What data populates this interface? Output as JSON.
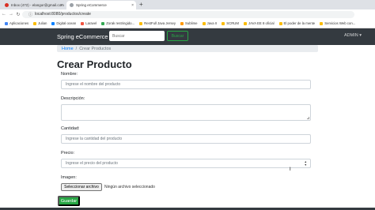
{
  "browser": {
    "tabs": [
      {
        "title": "Inbox (472) - elangor@gmail.com",
        "close": "×",
        "color": "#d93025"
      },
      {
        "title": "Spring eCommerce",
        "close": "×",
        "color": "#5f6368"
      }
    ],
    "new_tab": "+",
    "url": "localhost:8080/productos/create",
    "bookmarks": [
      {
        "label": "Aplicaciones",
        "color": "#4285f4"
      },
      {
        "label": "Julian",
        "color": "#fbbc04"
      },
      {
        "label": "Digital ocean",
        "color": "#0080ff"
      },
      {
        "label": "Laravel",
        "color": "#f05340"
      },
      {
        "label": "Zorak restringido...",
        "color": "#34a853"
      },
      {
        "label": "RestFull Java Jersey",
        "color": "#fbbc04"
      },
      {
        "label": "Sublime",
        "color": "#ff9800"
      },
      {
        "label": "Java II",
        "color": "#fbbc04"
      },
      {
        "label": "SCRUM",
        "color": "#fbbc04"
      },
      {
        "label": "JAVA EE 8 oficial",
        "color": "#fbbc04"
      },
      {
        "label": "El poder de la mente",
        "color": "#fbbc04"
      },
      {
        "label": "Servicios Web con...",
        "color": "#fbbc04"
      }
    ]
  },
  "navbar": {
    "brand": "Spring eCommerce",
    "search_placeholder": "Buscar",
    "search_button": "Buscar",
    "admin_label": "ADMIN ▾"
  },
  "breadcrumb": {
    "home": "Home",
    "separator": "/",
    "active": "Crear Productos"
  },
  "form": {
    "title": "Crear Producto",
    "fields": {
      "nombre": {
        "label": "Nombre:",
        "placeholder": "Ingrese el nombre del producto"
      },
      "descripcion": {
        "label": "Descripción:",
        "placeholder": ""
      },
      "cantidad": {
        "label": "Cantidad:",
        "placeholder": "Ingrese la cantidad del producto"
      },
      "precio": {
        "label": "Precio:",
        "placeholder": "Ingrese el precio del producto"
      },
      "imagen": {
        "label": "Imagen:",
        "button": "Seleccionar archivo",
        "status": "Ningún archivo seleccionado"
      }
    },
    "submit": "Guardar"
  },
  "colors": {
    "navbar": "#343a40",
    "success": "#28a745",
    "link": "#007bff"
  }
}
